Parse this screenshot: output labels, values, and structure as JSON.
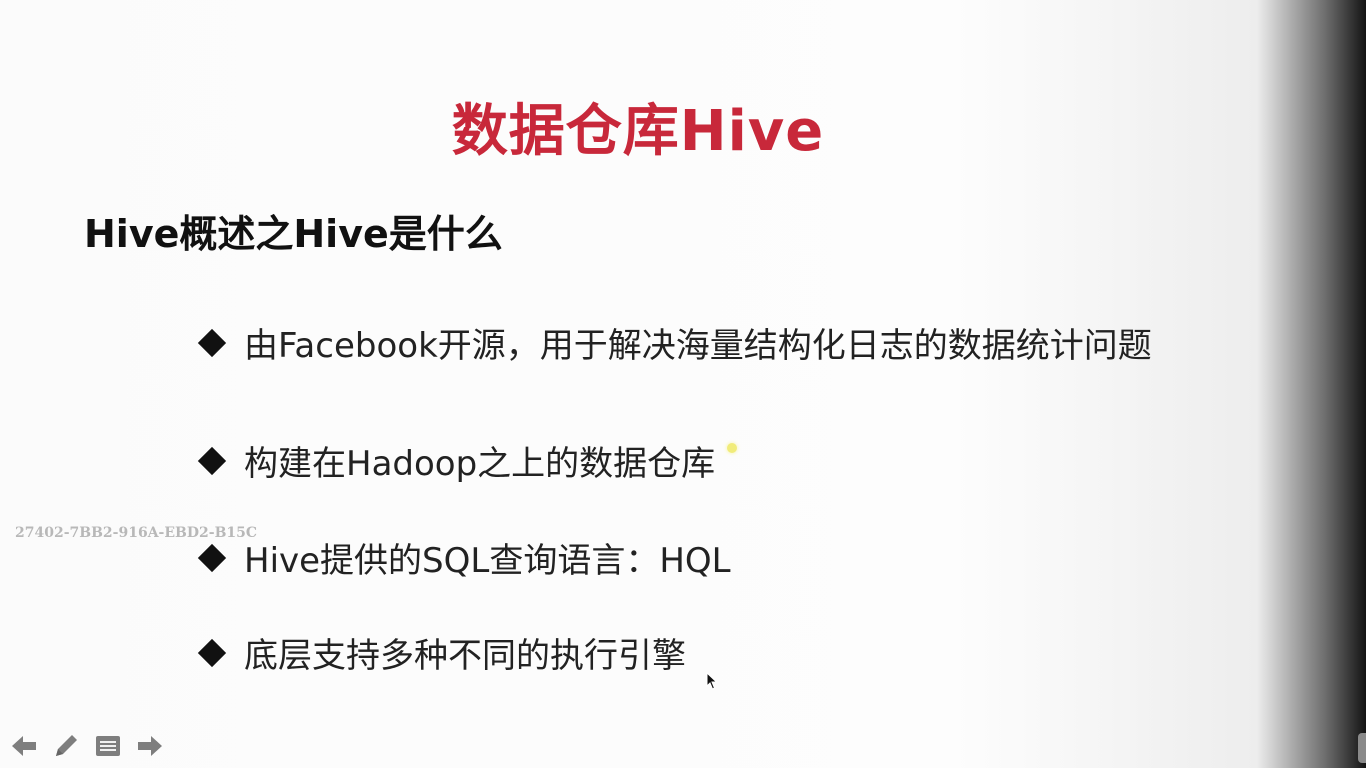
{
  "slide": {
    "title": "数据仓库Hive",
    "subtitle": "Hive概述之Hive是什么",
    "bullets": [
      "由Facebook开源，用于解决海量结构化日志的数据统计问题",
      "构建在Hadoop之上的数据仓库",
      "Hive提供的SQL查询语言：HQL",
      "底层支持多种不同的执行引擎"
    ]
  },
  "watermark": "27402-7BB2-916A-EBD2-B15C",
  "toolbar": {
    "buttons": [
      {
        "icon": "arrow-left-icon"
      },
      {
        "icon": "pen-icon"
      },
      {
        "icon": "menu-icon"
      },
      {
        "icon": "arrow-right-icon"
      }
    ]
  },
  "colors": {
    "title": "#c8283a",
    "text": "#222222",
    "background": "#fbfbfb",
    "laser": "#f1ec7a"
  }
}
